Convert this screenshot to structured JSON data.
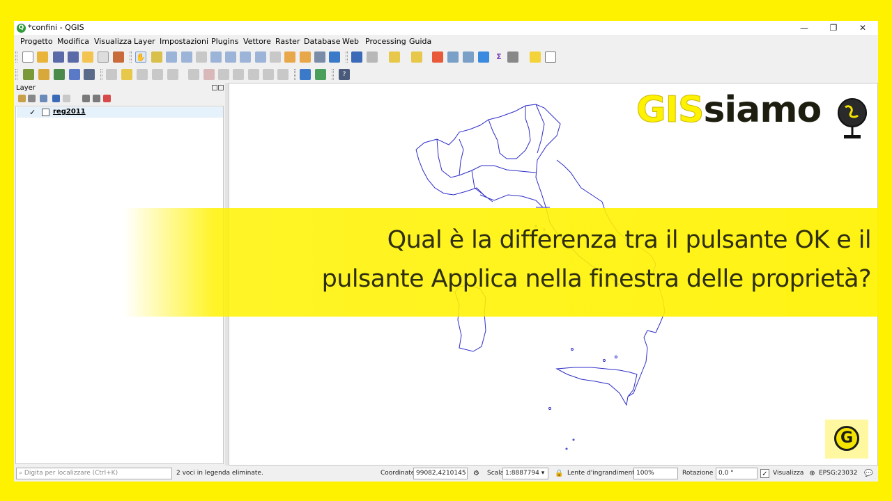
{
  "window": {
    "title": "*confini - QGIS",
    "controls": [
      "—",
      "❐",
      "✕"
    ]
  },
  "menu": [
    "Progetto",
    "Modifica",
    "Visualizza",
    "Layer",
    "Impostazioni",
    "Plugins",
    "Vettore",
    "Raster",
    "Database",
    "Web",
    "Processing",
    "Guida"
  ],
  "layers_panel": {
    "title": "Layer",
    "layers": [
      {
        "name": "reg2011",
        "checked": true,
        "check_glyph": "✓"
      }
    ]
  },
  "statusbar": {
    "locator_placeholder": "Digita per localizzare (Ctrl+K)",
    "message": "2 voci in legenda eliminate.",
    "coordinate_label": "Coordinate",
    "coordinate_value": "99082,4210145",
    "scale_label": "Scala",
    "scale_value": "1:8887794",
    "magnifier_label": "Lente d'ingrandimento",
    "magnifier_value": "100%",
    "rotation_label": "Rotazione",
    "rotation_value": "0,0 °",
    "render_label": "Visualizza",
    "render_check": "✓",
    "crs": "EPSG:23032"
  },
  "overlay": {
    "line1": "Qual è la differenza tra il pulsante OK e il",
    "line2": "pulsante Applica nella finestra delle proprietà?"
  },
  "logo": {
    "part1": "GIS",
    "part2": "siamo"
  },
  "colors": {
    "background": "#fff200",
    "layer_outline": "#2c2cc8",
    "banner_text": "#2e2e10"
  }
}
